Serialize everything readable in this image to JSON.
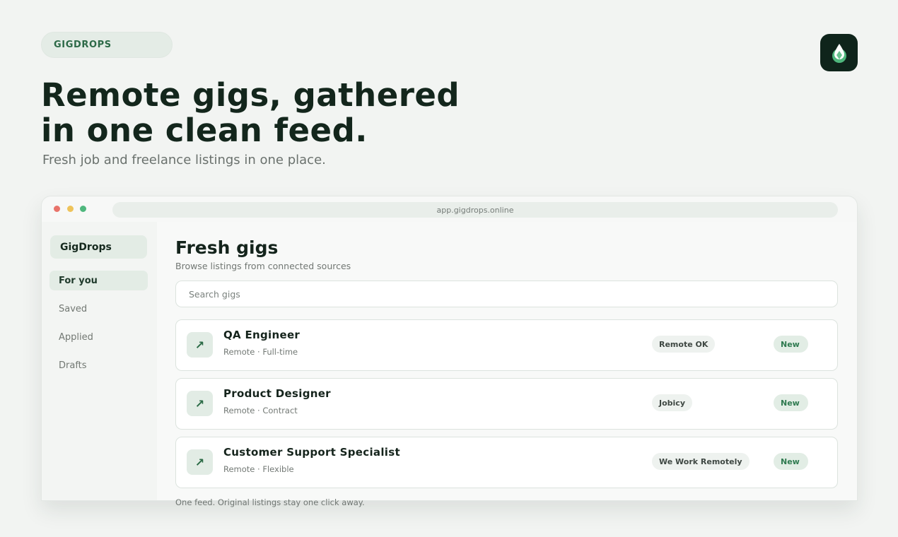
{
  "brand": {
    "pill_label": "GIGDROPS"
  },
  "hero": {
    "title_line1": "Remote gigs, gathered",
    "title_line2": "in one clean feed.",
    "subtitle": "Fresh job and freelance listings in one place."
  },
  "browser": {
    "address": "app.gigdrops.online"
  },
  "sidebar": {
    "brand": "GigDrops",
    "items": [
      {
        "label": "For you",
        "active": true
      },
      {
        "label": "Saved"
      },
      {
        "label": "Applied"
      },
      {
        "label": "Drafts"
      }
    ]
  },
  "main": {
    "title": "Fresh gigs",
    "subtitle": "Browse listings from connected sources",
    "search_placeholder": "Search gigs"
  },
  "listings": [
    {
      "icon": "arrow-up-right-icon",
      "title": "QA Engineer",
      "meta": "Remote · Full-time",
      "source": "Remote OK",
      "badge": "New"
    },
    {
      "icon": "arrow-up-right-icon",
      "title": "Product Designer",
      "meta": "Remote · Contract",
      "source": "Jobicy",
      "badge": "New"
    },
    {
      "icon": "arrow-up-right-icon",
      "title": "Customer Support Specialist",
      "meta": "Remote · Flexible",
      "source": "We Work Remotely",
      "badge": "New"
    }
  ],
  "footer_note": "One feed. Original listings stay one click away.",
  "colors": {
    "accent": "#2d6a48",
    "dark": "#0f241b",
    "background": "#f2f4f2"
  }
}
